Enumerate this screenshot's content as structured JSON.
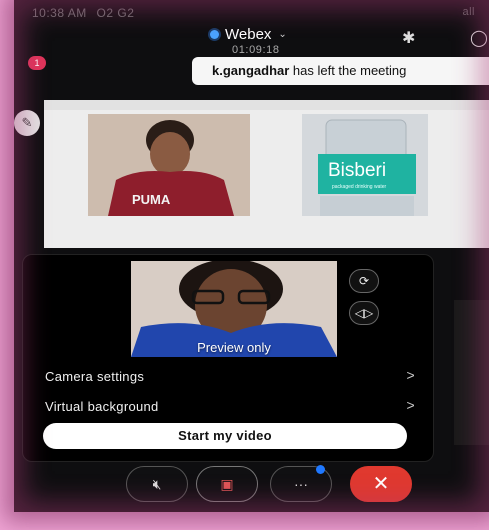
{
  "status_bar": {
    "time": "10:38 AM",
    "extra": "O2 G2",
    "right": "all"
  },
  "header": {
    "title": "Webex",
    "timer": "01:09:18"
  },
  "badge_count": "1",
  "toast": {
    "user": "k.gangadhar",
    "message": " has left the meeting"
  },
  "shared_content": {
    "image1_text": "PUMA",
    "image2_text": "Bisberi",
    "image2_sub": "packaged drinking water"
  },
  "panel": {
    "preview_label": "Preview only",
    "camera_settings": "Camera settings",
    "virtual_background": "Virtual background",
    "start_video": "Start my video"
  },
  "controls": {
    "more": "···",
    "end": "✕"
  }
}
